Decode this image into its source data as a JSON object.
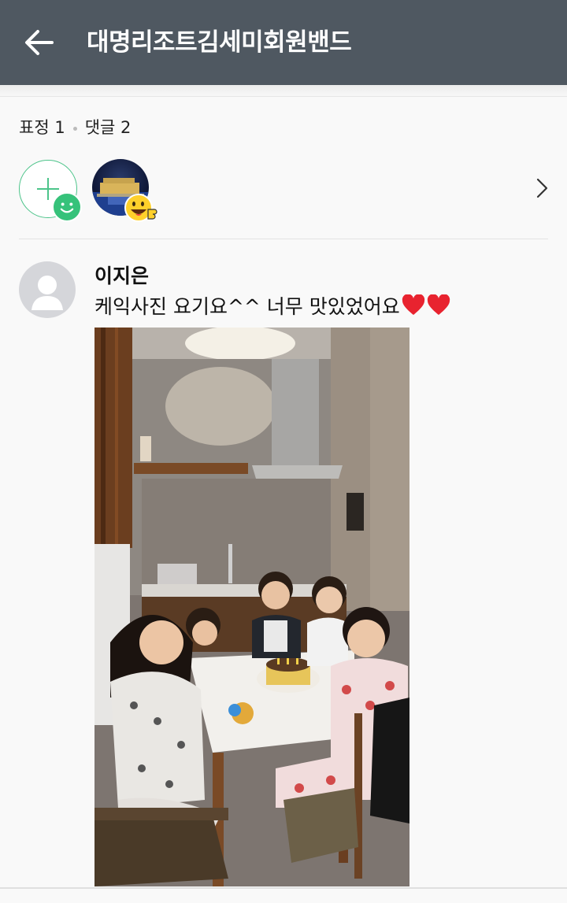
{
  "header": {
    "title": "대명리조트김세미회원밴드"
  },
  "reactions": {
    "expression_label": "표정",
    "expression_count": "1",
    "comment_label": "댓글",
    "comment_count": "2"
  },
  "comment": {
    "author": "이지은",
    "text": "케익사진 요기요^^ 너무 맛있었어요",
    "emoji": [
      "heart",
      "heart"
    ]
  },
  "icons": {
    "back": "arrow-left-icon",
    "add": "plus-icon",
    "smile": "smile-icon",
    "chevron": "chevron-right-icon",
    "heart": "heart-icon"
  },
  "colors": {
    "header_bg": "#4f5861",
    "accent_green": "#36c27a",
    "heart_red": "#e8232f"
  }
}
